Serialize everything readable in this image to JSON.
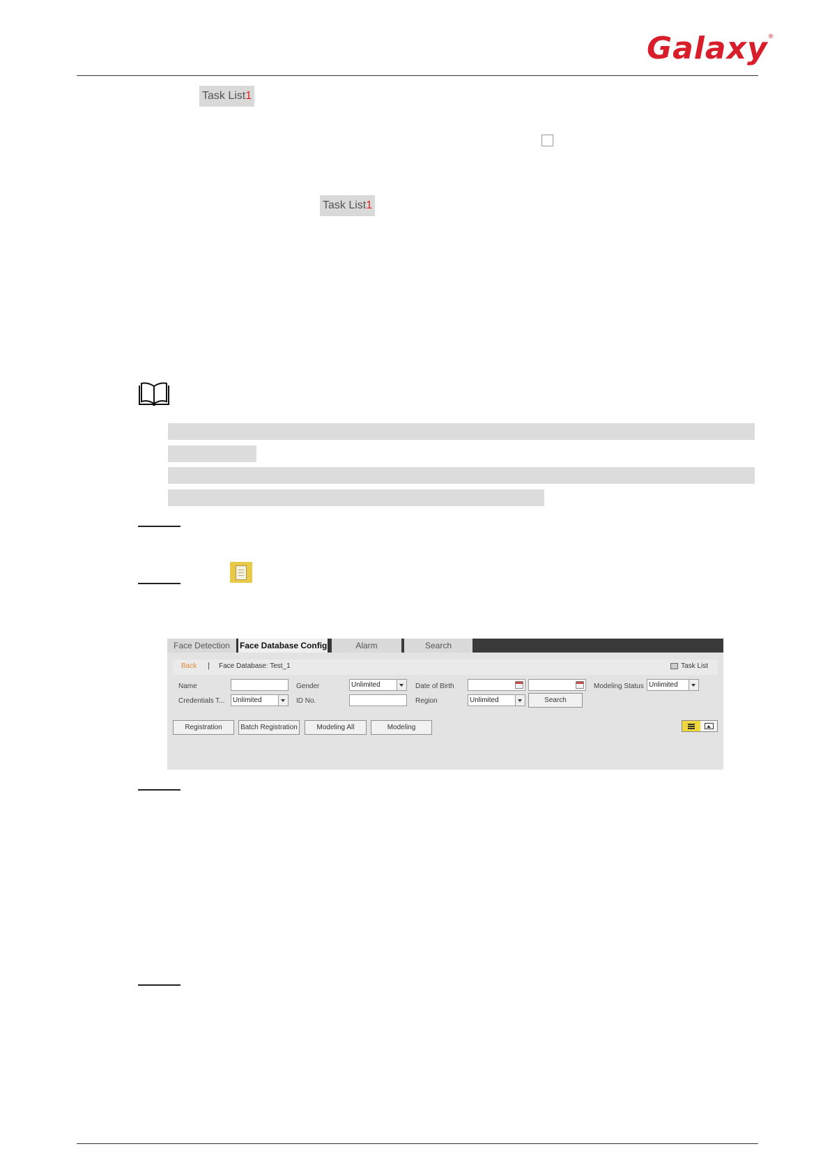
{
  "header": {
    "logo_text": "Galaxy",
    "logo_mark": "®",
    "brand_color": "#d81e2a"
  },
  "inline_labels": {
    "task_list_text": "Task List",
    "task_list_count": "1"
  },
  "icons": {
    "note": "book-icon",
    "task_list": "notebook-icon"
  },
  "screenshot": {
    "tabs": [
      "Face Detection",
      "Face Database Config",
      "Alarm",
      "Search"
    ],
    "active_tab": "Face Database Config",
    "back_label": "Back",
    "separator": "|",
    "database_label": "Face Database: Test_1",
    "task_list_label": "Task List",
    "filters": {
      "name_label": "Name",
      "gender_label": "Gender",
      "gender_value": "Unlimited",
      "dob_label": "Date of Birth",
      "modeling_status_label": "Modeling Status",
      "modeling_status_value": "Unlimited",
      "credentials_label": "Credentials T...",
      "credentials_value": "Unlimited",
      "id_label": "ID No.",
      "region_label": "Region",
      "region_value": "Unlimited",
      "search_button": "Search"
    },
    "actions": {
      "registration": "Registration",
      "batch_registration": "Batch Registration",
      "modeling_all": "Modeling All",
      "modeling": "Modeling"
    }
  }
}
